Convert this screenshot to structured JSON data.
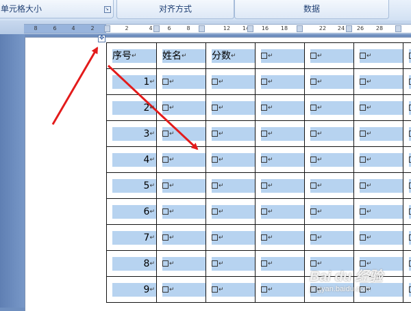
{
  "ribbon": {
    "groups": [
      {
        "label": "单元格大小"
      },
      {
        "label": "对齐方式"
      },
      {
        "label": "数据"
      }
    ]
  },
  "ruler": {
    "left_numbers": [
      "8",
      "6",
      "4",
      "2"
    ],
    "right_numbers": [
      "2",
      "4",
      "6",
      "8",
      "12",
      "14",
      "16",
      "18",
      "22",
      "24",
      "26",
      "28"
    ]
  },
  "table": {
    "headers": [
      "序号",
      "姓名",
      "分数"
    ],
    "row_numbers": [
      "1",
      "2",
      "3",
      "4",
      "5",
      "6",
      "7",
      "8",
      "9"
    ],
    "return_mark": "↵"
  },
  "watermark": {
    "logo": "Bai du 经验",
    "url": "jingyan.baidu.com"
  },
  "colors": {
    "cell_shading": "#b7d3f0",
    "arrow": "#e31b1b",
    "ribbon_text": "#1f3f73"
  },
  "icons": [
    "table-move-handle-icon",
    "dialog-launcher-icon"
  ]
}
